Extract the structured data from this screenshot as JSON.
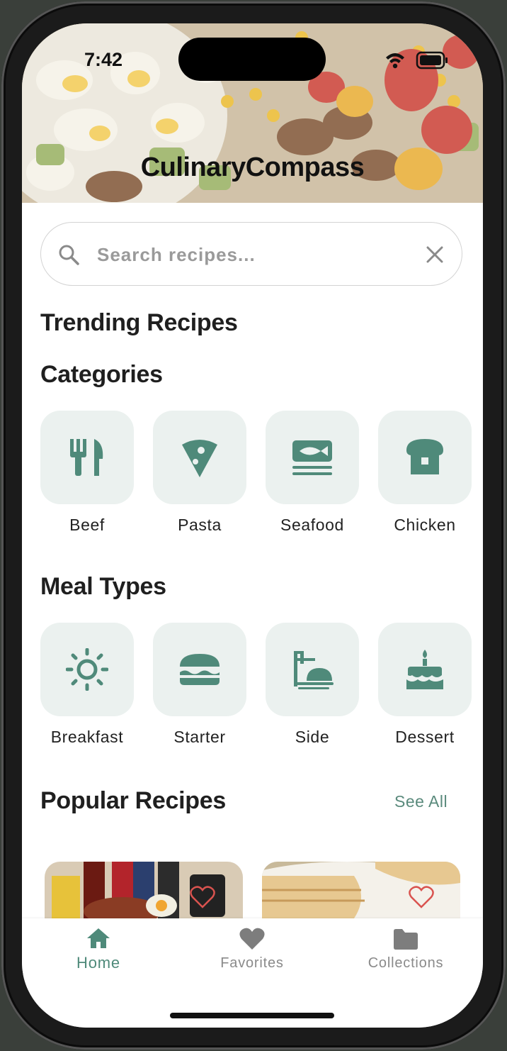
{
  "status": {
    "time": "7:42"
  },
  "app": {
    "title": "CulinaryCompass"
  },
  "search": {
    "placeholder": "Search recipes..."
  },
  "sections": {
    "trending": "Trending Recipes",
    "categories": "Categories",
    "meal_types": "Meal Types",
    "popular": "Popular Recipes",
    "see_all": "See All"
  },
  "categories": [
    {
      "label": "Beef",
      "icon": "cutlery-icon"
    },
    {
      "label": "Pasta",
      "icon": "pizza-slice-icon"
    },
    {
      "label": "Seafood",
      "icon": "fish-icon"
    },
    {
      "label": "Chicken",
      "icon": "bread-icon"
    }
  ],
  "meal_types": [
    {
      "label": "Breakfast",
      "icon": "sun-icon"
    },
    {
      "label": "Starter",
      "icon": "burger-icon"
    },
    {
      "label": "Side",
      "icon": "side-dish-icon"
    },
    {
      "label": "Dessert",
      "icon": "cake-icon"
    }
  ],
  "nav": [
    {
      "label": "Home",
      "icon": "home-icon",
      "active": true
    },
    {
      "label": "Favorites",
      "icon": "heart-icon",
      "active": false
    },
    {
      "label": "Collections",
      "icon": "folder-icon",
      "active": false
    }
  ],
  "colors": {
    "accent": "#4f8a7a",
    "tile_bg": "#ebf1ef",
    "text": "#1f1f1f",
    "favorite": "#d9534f"
  }
}
